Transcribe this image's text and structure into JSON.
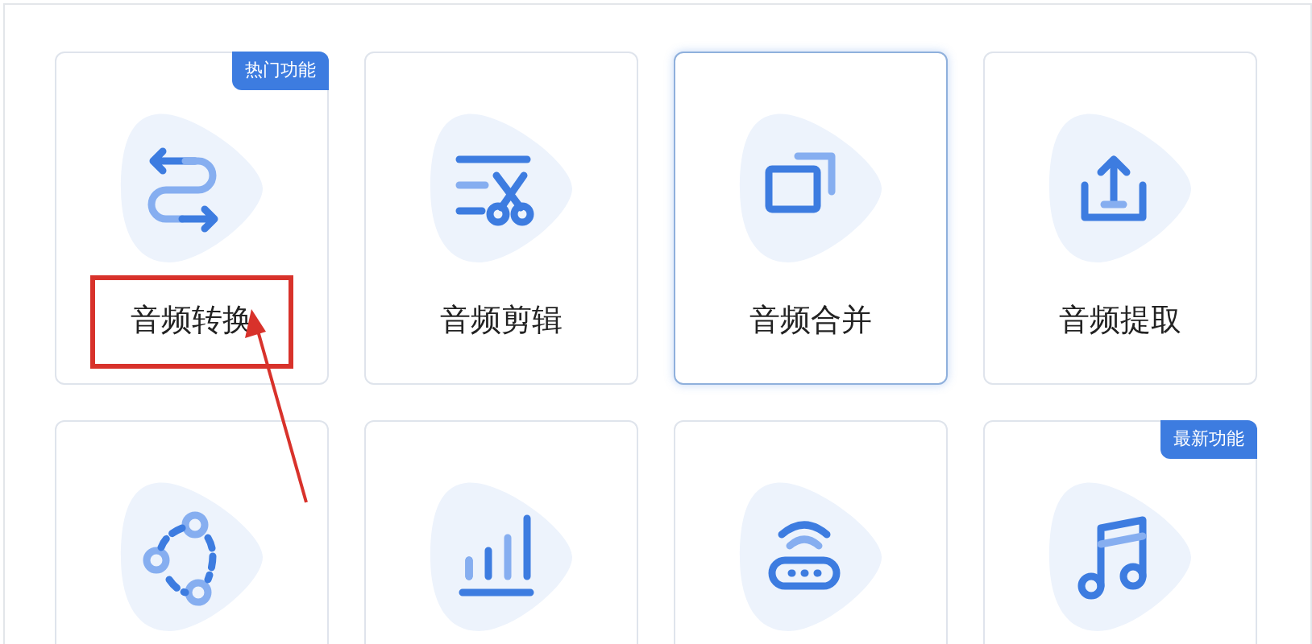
{
  "cards": [
    {
      "label": "音频转换",
      "kind": "swap",
      "selected": false,
      "badge": "热门功能",
      "highlighted": true
    },
    {
      "label": "音频剪辑",
      "kind": "cut",
      "selected": false,
      "highlighted": false
    },
    {
      "label": "音频合并",
      "kind": "merge",
      "selected": true,
      "highlighted": false
    },
    {
      "label": "音频提取",
      "kind": "extract",
      "selected": false,
      "highlighted": false
    },
    {
      "kind": "share",
      "selected": false
    },
    {
      "kind": "bars",
      "selected": false
    },
    {
      "kind": "router",
      "selected": false
    },
    {
      "kind": "music",
      "selected": false,
      "badge": "最新功能"
    }
  ]
}
